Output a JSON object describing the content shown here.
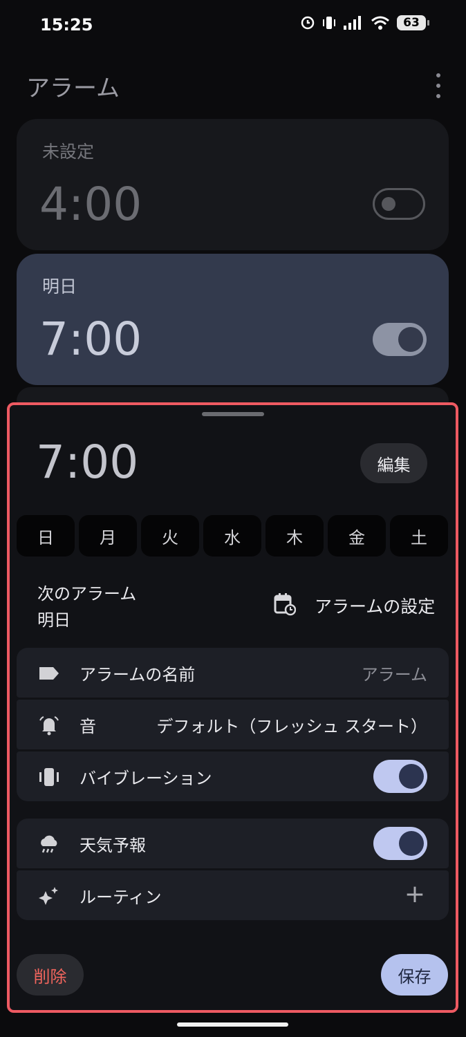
{
  "status_bar": {
    "time": "15:25",
    "battery": "63"
  },
  "header": {
    "title": "アラーム"
  },
  "alarms": [
    {
      "day_label": "未設定",
      "time": "4:00",
      "enabled": false
    },
    {
      "day_label": "明日",
      "time": "7:00",
      "enabled": true
    }
  ],
  "sheet": {
    "time": "7:00",
    "edit_label": "編集",
    "days": [
      "日",
      "月",
      "火",
      "水",
      "木",
      "金",
      "土"
    ],
    "next_alarm_label": "次のアラーム",
    "next_alarm_value": "明日",
    "set_alarm_label": "アラームの設定",
    "settings": {
      "name": {
        "label": "アラームの名前",
        "value": "アラーム"
      },
      "sound": {
        "label": "音",
        "value": "デフォルト（フレッシュ スタート）"
      },
      "vibration": {
        "label": "バイブレーション",
        "enabled": true
      },
      "weather": {
        "label": "天気予報",
        "enabled": true
      },
      "routine": {
        "label": "ルーティン",
        "action": "+"
      }
    },
    "delete_label": "削除",
    "save_label": "保存"
  },
  "colors": {
    "accent": "#bfc8f0",
    "danger": "#f1655d",
    "highlight_border": "#ee5a62"
  }
}
